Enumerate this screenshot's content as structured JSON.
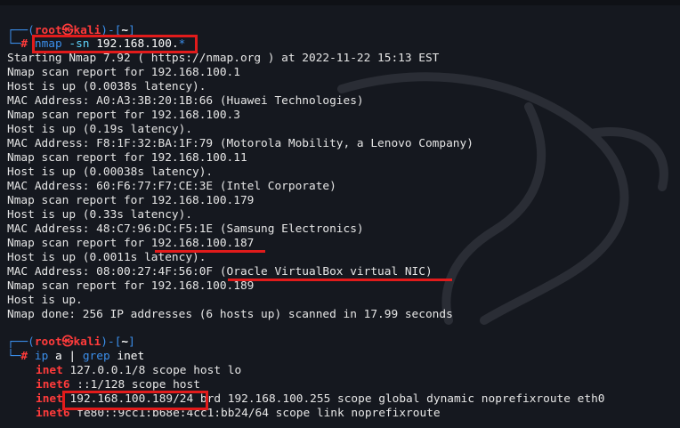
{
  "prompt1": {
    "bracket_open": "┌──(",
    "user": "root",
    "at": "㉿",
    "host": "kali",
    "mid": ")-[",
    "dir": "~",
    "close": "]",
    "branch": "└─",
    "hash": "#",
    "cmd": "nmap",
    "args": " -sn ",
    "target": "192.168.100.",
    "glob": "*"
  },
  "nmap_output": [
    "Starting Nmap 7.92 ( https://nmap.org ) at 2022-11-22 15:13 EST",
    "Nmap scan report for 192.168.100.1",
    "Host is up (0.0038s latency).",
    "MAC Address: A0:A3:3B:20:1B:66 (Huawei Technologies)",
    "Nmap scan report for 192.168.100.3",
    "Host is up (0.19s latency).",
    "MAC Address: F8:1F:32:BA:1F:79 (Motorola Mobility, a Lenovo Company)",
    "Nmap scan report for 192.168.100.11",
    "Host is up (0.00038s latency).",
    "MAC Address: 60:F6:77:F7:CE:3E (Intel Corporate)",
    "Nmap scan report for 192.168.100.179",
    "Host is up (0.33s latency).",
    "MAC Address: 48:C7:96:DC:F5:1E (Samsung Electronics)",
    "Nmap scan report for 192.168.100.187",
    "Host is up (0.0011s latency).",
    "MAC Address: 08:00:27:4F:56:0F (Oracle VirtualBox virtual NIC)",
    "Nmap scan report for 192.168.100.189",
    "Host is up.",
    "Nmap done: 256 IP addresses (6 hosts up) scanned in 17.99 seconds"
  ],
  "prompt2": {
    "bracket_open": "┌──(",
    "user": "root",
    "at": "㉿",
    "host": "kali",
    "mid": ")-[",
    "dir": "~",
    "close": "]",
    "branch": "└─",
    "hash": "#",
    "cmd": "ip",
    "args": " a ",
    "pipe": "|",
    "grep": " grep",
    "grep_arg": " inet"
  },
  "ip_output": [
    {
      "key": "inet",
      "rest": " 127.0.0.1/8 scope host lo"
    },
    {
      "key": "inet6",
      "rest": " ::1/128 scope host"
    },
    {
      "key": "inet",
      "rest": " 192.168.100.189/24 brd 192.168.100.255 scope global dynamic noprefixroute eth0"
    },
    {
      "key": "inet6",
      "rest": " fe80::9cc1:b68e:4cc1:bb24/64 scope link noprefixroute"
    }
  ],
  "colors": {
    "background": "#15181f",
    "prompt_blue": "#3b8eea",
    "prompt_red": "#ff3b3b",
    "highlight_red": "#e11b1b"
  }
}
